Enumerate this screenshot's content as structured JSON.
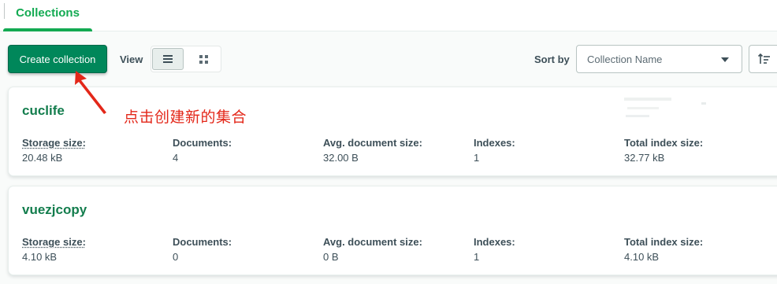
{
  "tabs": [
    {
      "label": "Collections",
      "active": true
    }
  ],
  "toolbar": {
    "create_label": "Create collection",
    "view_label": "View",
    "view_modes": [
      "list",
      "grid"
    ],
    "active_view": "list",
    "sort_label": "Sort by",
    "sort_value": "Collection Name"
  },
  "annotation": "点击创建新的集合",
  "stat_labels": {
    "storage": "Storage size:",
    "documents": "Documents:",
    "avg": "Avg. document size:",
    "indexes": "Indexes:",
    "total_index": "Total index size:"
  },
  "collections": [
    {
      "name": "cuclife",
      "storage": "20.48 kB",
      "documents": "4",
      "avg": "32.00 B",
      "indexes": "1",
      "total_index": "32.77 kB"
    },
    {
      "name": "vuezjcopy",
      "storage": "4.10 kB",
      "documents": "0",
      "avg": "0 B",
      "indexes": "1",
      "total_index": "4.10 kB"
    }
  ],
  "colors": {
    "brand_green": "#13aa52",
    "button_green": "#00875a",
    "title_green": "#137d4d",
    "annotation_red": "#e32719"
  }
}
